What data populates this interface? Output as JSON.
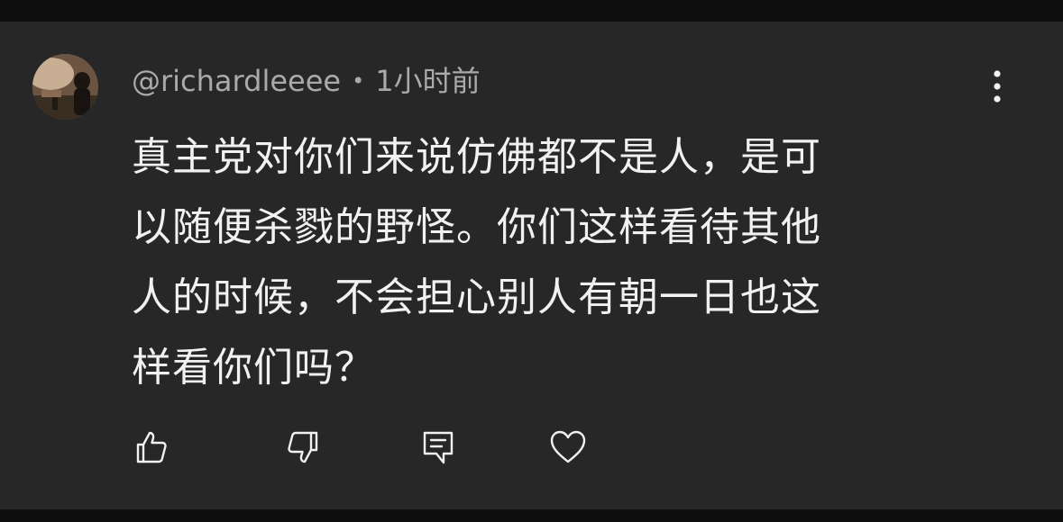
{
  "comment": {
    "author": "@richardleeee",
    "separator": "•",
    "timestamp": "1小时前",
    "text_lines": [
      "真主党对你们来说仿佛都不是人，是可",
      "以随便杀戮的野怪。你们这样看待其他",
      "人的时候，不会担心别人有朝一日也这",
      "样看你们吗？"
    ]
  },
  "icons": {
    "more": "more-vertical-icon",
    "like": "thumbs-up-icon",
    "dislike": "thumbs-down-icon",
    "reply": "reply-icon",
    "heart": "heart-icon"
  },
  "colors": {
    "page_background": "#0f0f0f",
    "card_background": "#272727",
    "text_primary": "#f1f1f1",
    "text_secondary": "#aaaaaa"
  }
}
